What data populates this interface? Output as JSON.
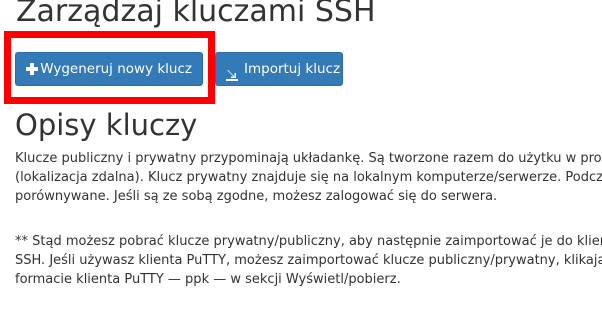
{
  "header": {
    "title": "Zarządzaj kluczami SSH"
  },
  "toolbar": {
    "generate_label": "Wygeneruj nowy klucz",
    "import_label": "Importuj klucz",
    "button_color": "#337ab7",
    "highlight_color": "#ff0000",
    "icons": [
      "plus-icon",
      "import-icon"
    ]
  },
  "section": {
    "title": "Opisy kluczy",
    "paragraph1": [
      "Klucze publiczny i prywatny przypominają układankę. Są tworzone razem do użytku w proc",
      "(lokalizacja zdalna). Klucz prywatny znajduje się na lokalnym komputerze/serwerze. Podcza",
      "porównywane. Jeśli są ze sobą zgodne, możesz zalogować się do serwera."
    ],
    "paragraph2": [
      "** Stąd możesz pobrać klucze prywatny/publiczny, aby następnie zaimportować je do klien",
      "SSH. Jeśli używasz klienta PuTTY, możesz zaimportować klucze publiczny/prywatny, klikając",
      "formacie klienta PuTTY — ppk — w sekcji Wyświetl/pobierz."
    ]
  }
}
